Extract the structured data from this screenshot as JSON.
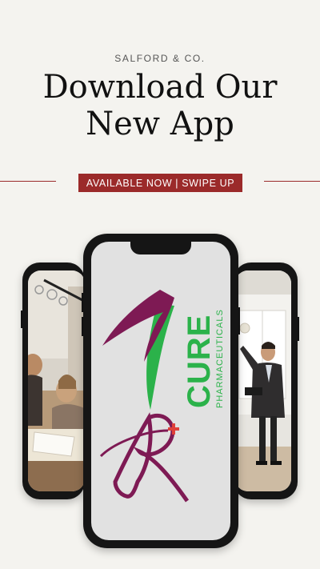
{
  "brand": "SALFORD & CO.",
  "headline": {
    "line1": "Download Our",
    "line2": "New App"
  },
  "badge": "AVAILABLE NOW | SWIPE UP",
  "colors": {
    "accent": "#9b2a2a",
    "background": "#f4f3ef",
    "logo_magenta": "#7e1a54",
    "logo_green": "#2bb24a",
    "plus_red": "#e0403a"
  },
  "logo": {
    "word": "CURE",
    "sub": "PHARMACEUTICALS",
    "monogram": "R"
  },
  "phones": [
    {
      "position": "left",
      "content": "photo of team reviewing documents at a table"
    },
    {
      "position": "center",
      "content": "app splash screen with logo"
    },
    {
      "position": "right",
      "content": "photo of man in suit presenting"
    }
  ]
}
